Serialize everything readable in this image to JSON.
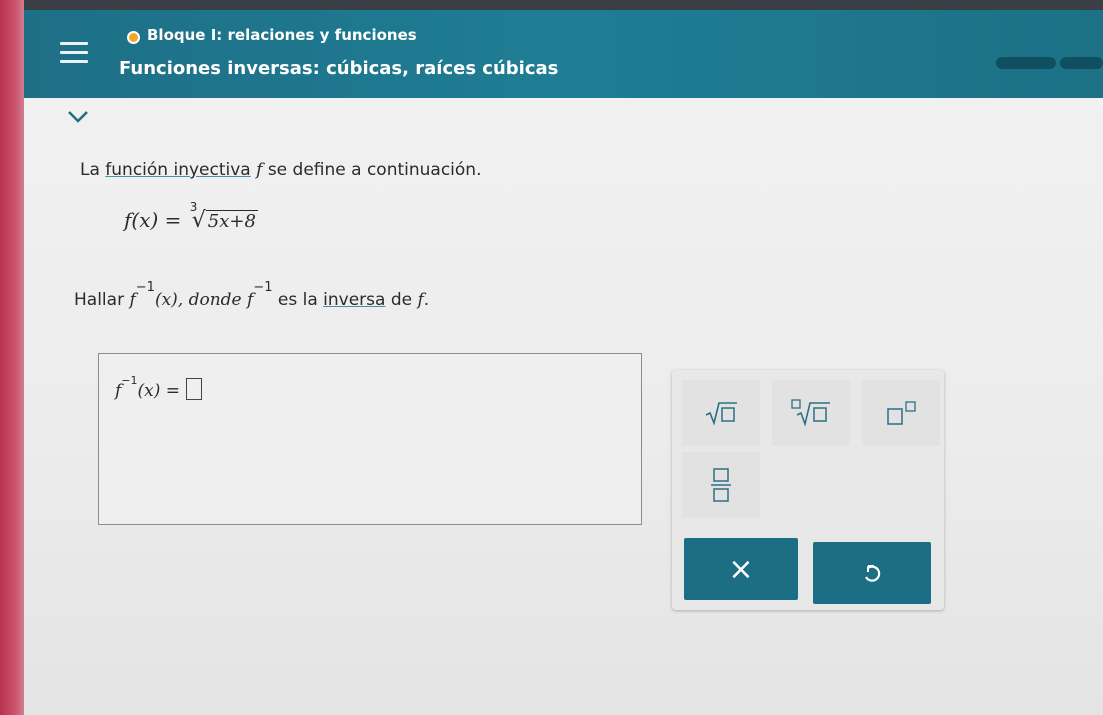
{
  "header": {
    "section": "Bloque I: relaciones y funciones",
    "lesson": "Funciones inversas: cúbicas, raíces cúbicas",
    "status_color": "#f5a623"
  },
  "question": {
    "intro_link": "función inyectiva",
    "intro_prefix": "La ",
    "intro_suffix": " se define a continuación.",
    "f_symbol": "f",
    "function_lhs": "f(x) =",
    "root_index": "3",
    "radicand": "5x+8",
    "find_prefix": "Hallar ",
    "find_expr": "(x), donde ",
    "inverse_exp": "−1",
    "find_middle": " es la ",
    "inverse_link": "inversa",
    "find_suffix": " de ",
    "period": "."
  },
  "answer": {
    "lhs_f": "f",
    "lhs_exp": "−1",
    "lhs_rest": "(x) ="
  },
  "keypad": {
    "keys": [
      "sqrt-key",
      "nth-root-key",
      "power-key",
      "fraction-key"
    ],
    "clear_label": "×",
    "undo_icon": "undo-icon",
    "accent_color": "#1c6e84"
  }
}
